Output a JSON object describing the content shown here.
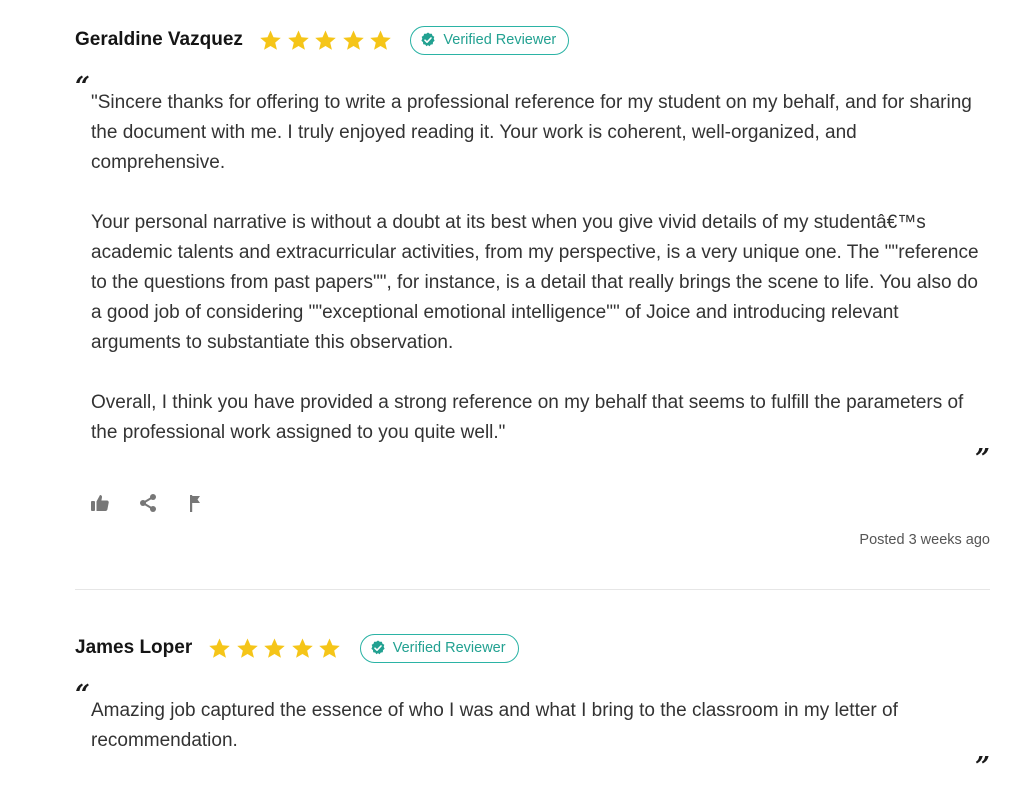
{
  "colors": {
    "star": "#f5c518",
    "badge": "#22a191",
    "icon": "#777777"
  },
  "reviews": [
    {
      "name": "Geraldine Vazquez",
      "rating": 5,
      "badge_label": "Verified Reviewer",
      "open_quote": "“",
      "close_quote": "”",
      "paragraphs": [
        "\"Sincere thanks for offering to write a professional reference for my student on my behalf, and for sharing the document with me. I truly enjoyed reading it.  Your work is coherent, well-organized, and comprehensive.",
        "Your personal narrative is without a doubt at its best when you give vivid details of my studentâ€™s academic talents and extracurricular activities, from my perspective, is a very unique one. The \"\"reference to the questions from past papers\"\", for instance, is a detail that really brings the scene to life. You also do a good job of considering \"\"exceptional emotional intelligence\"\" of Joice and introducing relevant arguments to substantiate this observation.",
        "Overall, I think you have provided a strong reference on my behalf that seems to fulfill the parameters of the professional work assigned to you quite well.\""
      ],
      "actions": [
        "thumbs-up-icon",
        "share-icon",
        "flag-icon"
      ],
      "posted": "Posted 3 weeks ago"
    },
    {
      "name": "James Loper",
      "rating": 5,
      "badge_label": "Verified Reviewer",
      "open_quote": "“",
      "close_quote": "”",
      "paragraphs": [
        "Amazing job captured the essence of who I was and what I bring to the classroom in my letter of recommendation."
      ]
    }
  ]
}
